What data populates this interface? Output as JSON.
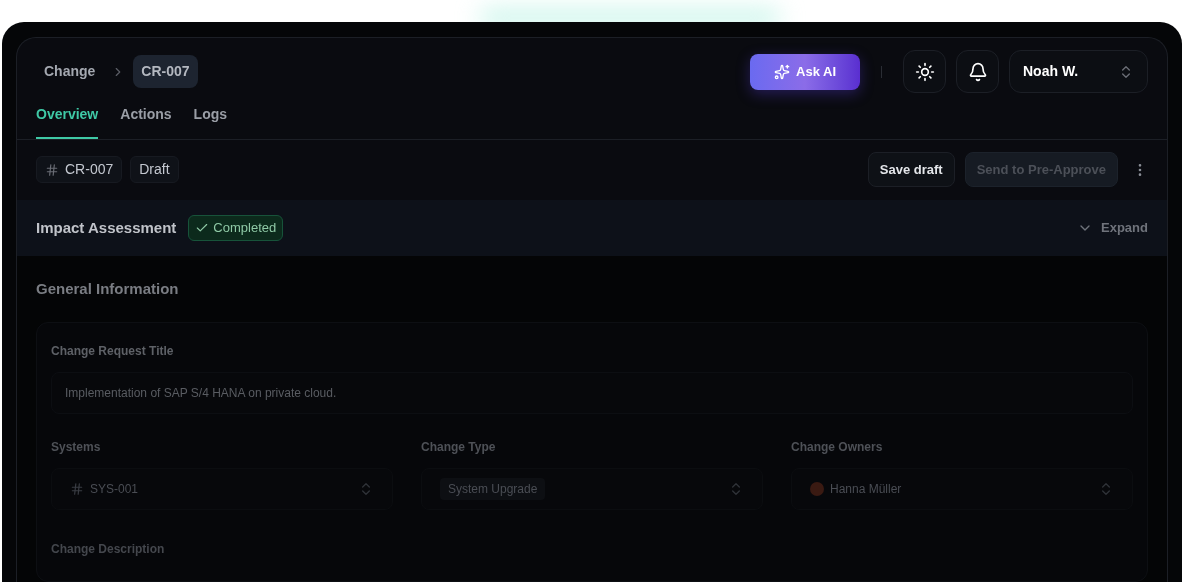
{
  "breadcrumb": [
    {
      "label": "Change",
      "selected": false
    },
    {
      "label": "CR-007",
      "selected": true
    }
  ],
  "header": {
    "ask_ai": "Ask AI",
    "user": "Noah W."
  },
  "tabs": [
    {
      "label": "Overview",
      "selected": true
    },
    {
      "label": "Actions",
      "selected": false
    },
    {
      "label": "Logs",
      "selected": false
    }
  ],
  "toolbar": {
    "id_tag": "CR-007",
    "status_tag": "Draft",
    "buttons": [
      {
        "label": "Save draft",
        "disabled": false
      },
      {
        "label": "Send to Pre-Approve",
        "disabled": true
      }
    ]
  },
  "impact": {
    "title": "Impact Assessment",
    "badge": "Completed",
    "expand": "Expand"
  },
  "general": {
    "title": "General Information",
    "title_field": {
      "label": "Change Request Title",
      "value": "Implementation of SAP S/4 HANA on private cloud."
    },
    "selects": [
      {
        "label": "Systems",
        "value": "SYS-001",
        "kind": "id"
      },
      {
        "label": "Change Type",
        "value": "System Upgrade",
        "kind": "tag"
      },
      {
        "label": "Change Owners",
        "value": "Hanna Müller",
        "kind": "person"
      }
    ],
    "next_label": "Change Description"
  }
}
